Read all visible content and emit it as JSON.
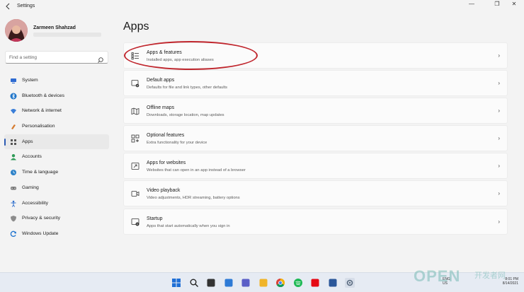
{
  "window": {
    "title": "Settings",
    "controls": [
      "—",
      "❐",
      "✕"
    ]
  },
  "profile": {
    "name": "Zarmeen Shahzad"
  },
  "search": {
    "placeholder": "Find a setting"
  },
  "sidebar": {
    "items": [
      {
        "label": "System",
        "icon": "system-icon",
        "color": "#2d6ad1"
      },
      {
        "label": "Bluetooth & devices",
        "icon": "bluetooth-icon",
        "color": "#1f75c9"
      },
      {
        "label": "Network & internet",
        "icon": "wifi-icon",
        "color": "#3a7ed8"
      },
      {
        "label": "Personalisation",
        "icon": "brush-icon",
        "color": "#d57b2f"
      },
      {
        "label": "Apps",
        "icon": "apps-icon",
        "color": "#555555",
        "active": true
      },
      {
        "label": "Accounts",
        "icon": "accounts-icon",
        "color": "#2e9a57"
      },
      {
        "label": "Time & language",
        "icon": "globe-clock-icon",
        "color": "#2d82c9"
      },
      {
        "label": "Gaming",
        "icon": "gamepad-icon",
        "color": "#777777"
      },
      {
        "label": "Accessibility",
        "icon": "accessibility-icon",
        "color": "#2f6fcc"
      },
      {
        "label": "Privacy & security",
        "icon": "shield-icon",
        "color": "#8c8c8c"
      },
      {
        "label": "Windows Update",
        "icon": "update-icon",
        "color": "#1f74cf"
      }
    ]
  },
  "main": {
    "title": "Apps",
    "cards": [
      {
        "title": "Apps & features",
        "subtitle": "Installed apps, app execution aliases",
        "icon": "apps-features-icon"
      },
      {
        "title": "Default apps",
        "subtitle": "Defaults for file and link types, other defaults",
        "icon": "default-apps-icon"
      },
      {
        "title": "Offline maps",
        "subtitle": "Downloads, storage location, map updates",
        "icon": "map-icon"
      },
      {
        "title": "Optional features",
        "subtitle": "Extra functionality for your device",
        "icon": "optional-features-icon"
      },
      {
        "title": "Apps for websites",
        "subtitle": "Websites that can open in an app instead of a browser",
        "icon": "website-app-icon"
      },
      {
        "title": "Video playback",
        "subtitle": "Video adjustments, HDR streaming, battery options",
        "icon": "video-icon"
      },
      {
        "title": "Startup",
        "subtitle": "Apps that start automatically when you sign in",
        "icon": "startup-icon"
      }
    ]
  },
  "taskbar": {
    "icons": [
      "start-icon",
      "search-icon",
      "task-view-icon",
      "widgets-icon",
      "chat-icon",
      "file-explorer-icon",
      "chrome-icon",
      "spotify-icon",
      "netflix-icon",
      "word-icon",
      "settings-icon"
    ],
    "lang_top": "ENG",
    "lang_bottom": "US",
    "time": "8:01 PM",
    "date": "8/14/2021"
  },
  "watermark": {
    "brand": "OPEN",
    "sub": "开发者网"
  }
}
